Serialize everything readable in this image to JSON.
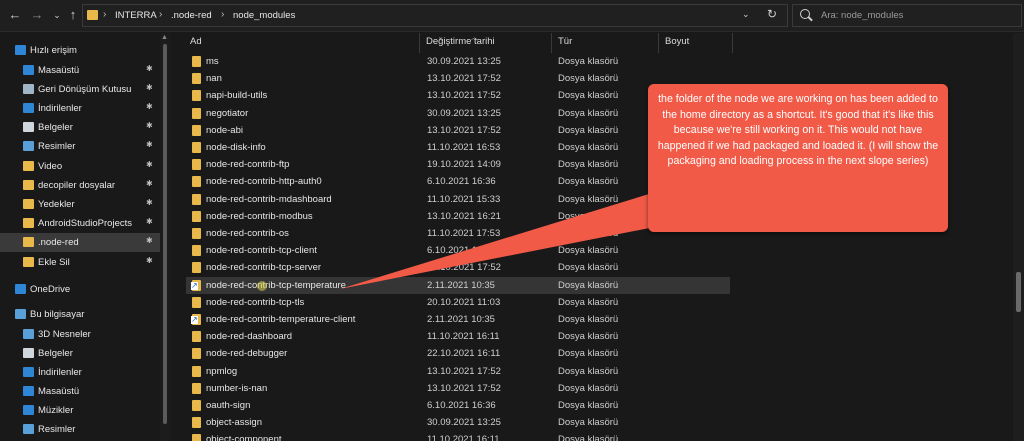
{
  "address_bar": {
    "crumbs": [
      "INTERRA",
      ".node-red",
      "node_modules"
    ],
    "search_placeholder": "Ara: node_modules"
  },
  "sidebar": {
    "items": [
      {
        "label": "Hızlı erişim",
        "icon": "star-icon",
        "pinned": false
      },
      {
        "label": "Masaüstü",
        "icon": "desktop-icon",
        "pinned": true
      },
      {
        "label": "Geri Dönüşüm Kutusu",
        "icon": "recycle-bin-icon",
        "pinned": true
      },
      {
        "label": "İndirilenler",
        "icon": "download-icon",
        "pinned": true
      },
      {
        "label": "Belgeler",
        "icon": "documents-icon",
        "pinned": true
      },
      {
        "label": "Resimler",
        "icon": "pictures-icon",
        "pinned": true
      },
      {
        "label": "Video",
        "icon": "folder-icon",
        "pinned": true
      },
      {
        "label": "decopiler dosyalar",
        "icon": "folder-icon",
        "pinned": true
      },
      {
        "label": "Yedekler",
        "icon": "folder-icon",
        "pinned": true
      },
      {
        "label": "AndroidStudioProjects",
        "icon": "folder-icon",
        "pinned": true
      },
      {
        "label": ".node-red",
        "icon": "folder-icon",
        "pinned": true
      },
      {
        "label": "Ekle Sil",
        "icon": "folder-icon",
        "pinned": true
      },
      {
        "label": "OneDrive",
        "icon": "cloud-icon",
        "pinned": false
      },
      {
        "label": "Bu bilgisayar",
        "icon": "computer-icon",
        "pinned": false
      },
      {
        "label": "3D Nesneler",
        "icon": "3d-objects-icon",
        "pinned": false
      },
      {
        "label": "Belgeler",
        "icon": "documents-icon",
        "pinned": false
      },
      {
        "label": "İndirilenler",
        "icon": "download-icon",
        "pinned": false
      },
      {
        "label": "Masaüstü",
        "icon": "desktop-icon",
        "pinned": false
      },
      {
        "label": "Müzikler",
        "icon": "music-icon",
        "pinned": false
      },
      {
        "label": "Resimler",
        "icon": "pictures-icon",
        "pinned": false
      }
    ]
  },
  "columns": {
    "name": "Ad",
    "date": "Değiştirme tarihi",
    "type": "Tür",
    "size": "Boyut"
  },
  "files": [
    {
      "name": "ms",
      "date": "30.09.2021 13:25",
      "type": "Dosya klasörü"
    },
    {
      "name": "nan",
      "date": "13.10.2021 17:52",
      "type": "Dosya klasörü"
    },
    {
      "name": "napi-build-utils",
      "date": "13.10.2021 17:52",
      "type": "Dosya klasörü"
    },
    {
      "name": "negotiator",
      "date": "30.09.2021 13:25",
      "type": "Dosya klasörü"
    },
    {
      "name": "node-abi",
      "date": "13.10.2021 17:52",
      "type": "Dosya klasörü"
    },
    {
      "name": "node-disk-info",
      "date": "11.10.2021 16:53",
      "type": "Dosya klasörü"
    },
    {
      "name": "node-red-contrib-ftp",
      "date": "19.10.2021 14:09",
      "type": "Dosya klasörü"
    },
    {
      "name": "node-red-contrib-http-auth0",
      "date": "6.10.2021 16:36",
      "type": "Dosya klasörü"
    },
    {
      "name": "node-red-contrib-mdashboard",
      "date": "11.10.2021 15:33",
      "type": "Dosya klasörü"
    },
    {
      "name": "node-red-contrib-modbus",
      "date": "13.10.2021 16:21",
      "type": "Dosya klasörü"
    },
    {
      "name": "node-red-contrib-os",
      "date": "11.10.2021 17:53",
      "type": "Dosya klasörü"
    },
    {
      "name": "node-red-contrib-tcp-client",
      "date": "6.10.2021 16:36",
      "type": "Dosya klasörü"
    },
    {
      "name": "node-red-contrib-tcp-server",
      "date": "13.10.2021 17:52",
      "type": "Dosya klasörü"
    },
    {
      "name": "node-red-contrib-tcp-temperature",
      "date": "2.11.2021 10:35",
      "type": "Dosya klasörü"
    },
    {
      "name": "node-red-contrib-tcp-tls",
      "date": "20.10.2021 11:03",
      "type": "Dosya klasörü"
    },
    {
      "name": "node-red-contrib-temperature-client",
      "date": "2.11.2021 10:35",
      "type": "Dosya klasörü"
    },
    {
      "name": "node-red-dashboard",
      "date": "11.10.2021 16:11",
      "type": "Dosya klasörü"
    },
    {
      "name": "node-red-debugger",
      "date": "22.10.2021 16:11",
      "type": "Dosya klasörü"
    },
    {
      "name": "npmlog",
      "date": "13.10.2021 17:52",
      "type": "Dosya klasörü"
    },
    {
      "name": "number-is-nan",
      "date": "13.10.2021 17:52",
      "type": "Dosya klasörü"
    },
    {
      "name": "oauth-sign",
      "date": "6.10.2021 16:36",
      "type": "Dosya klasörü"
    },
    {
      "name": "object-assign",
      "date": "30.09.2021 13:25",
      "type": "Dosya klasörü"
    },
    {
      "name": "object-component",
      "date": "11.10.2021 16:11",
      "type": "Dosya klasörü"
    }
  ],
  "annotation": {
    "text": "the folder of the node we are working on has been added to the home directory as a shortcut. It's good that it's like this because we're still working on it. This would not have happened if we had packaged and loaded it. (I will show the packaging and loading process in the next slope series)"
  }
}
